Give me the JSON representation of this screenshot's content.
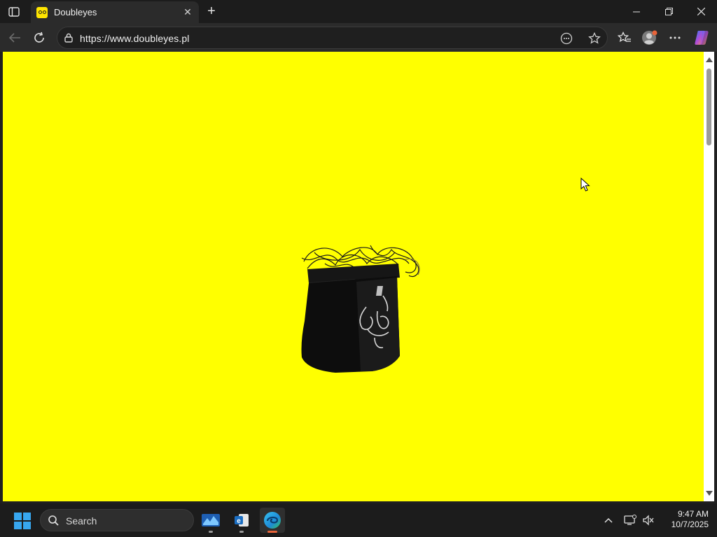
{
  "browser": {
    "tab": {
      "title": "Doubleyes"
    },
    "address": {
      "url": "https://www.doubleyes.pl"
    }
  },
  "page": {
    "background_color": "#ffff00",
    "hero_image": "black-bag-with-scribbled-wires-icon"
  },
  "taskbar": {
    "search_label": "Search",
    "apps": [
      "stocks-app-icon",
      "outlook-app-icon",
      "edge-browser-icon"
    ],
    "clock": {
      "time": "9:47 AM",
      "date": "10/7/2025"
    }
  },
  "colors": {
    "accent": "#ffff00",
    "taskbar_active": "#e8643a",
    "windows_blue": "#37a7f0"
  }
}
